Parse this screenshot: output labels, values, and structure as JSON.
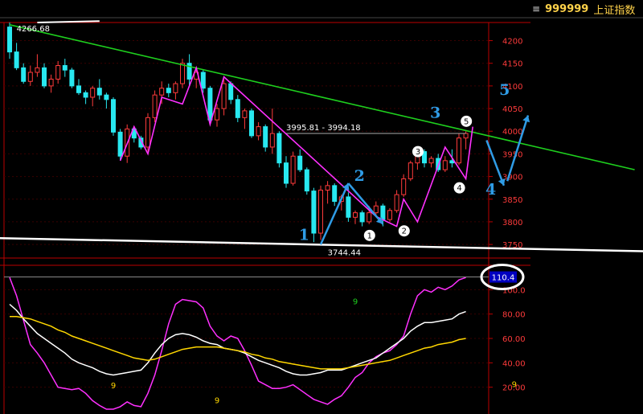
{
  "header": {
    "menu_glyph": "≡",
    "code": "999999",
    "name": "上证指数"
  },
  "chart_data": [
    {
      "type": "candlestick",
      "title": "",
      "ylim": [
        3720,
        4240
      ],
      "y_ticks": [
        "4200",
        "4150",
        "4100",
        "4050",
        "4000",
        "3950",
        "3900",
        "3850",
        "3800",
        "3750"
      ],
      "y_tick_values": [
        4200,
        4150,
        4100,
        4050,
        4000,
        3950,
        3900,
        3850,
        3800,
        3750
      ],
      "high_label": "4266.68",
      "low_label": "3744.44",
      "low_label_value": 3744,
      "range_label": "3995.81 - 3994.18",
      "range_value": 3995,
      "colors": {
        "up": "#ff3b3b",
        "down": "#28e8f0",
        "trendline": "#1ecf1e",
        "zigzag": "#ff30ff",
        "arrow": "#2f9ce6",
        "support": "#ffffff"
      },
      "candles": [
        [
          4230,
          4240,
          4160,
          4175
        ],
        [
          4175,
          4195,
          4135,
          4140
        ],
        [
          4140,
          4150,
          4105,
          4110
        ],
        [
          4110,
          4145,
          4100,
          4130
        ],
        [
          4130,
          4170,
          4120,
          4140
        ],
        [
          4140,
          4150,
          4095,
          4100
        ],
        [
          4100,
          4125,
          4085,
          4115
        ],
        [
          4115,
          4155,
          4105,
          4145
        ],
        [
          4145,
          4160,
          4120,
          4135
        ],
        [
          4135,
          4140,
          4095,
          4100
        ],
        [
          4100,
          4115,
          4080,
          4085
        ],
        [
          4085,
          4090,
          4060,
          4075
        ],
        [
          4075,
          4100,
          4055,
          4095
        ],
        [
          4095,
          4115,
          4070,
          4080
        ],
        [
          4080,
          4085,
          4050,
          4070
        ],
        [
          4070,
          4075,
          3990,
          3998
        ],
        [
          3998,
          4005,
          3935,
          3945
        ],
        [
          3945,
          4015,
          3930,
          4005
        ],
        [
          4005,
          4010,
          3975,
          3985
        ],
        [
          3985,
          3990,
          3960,
          3965
        ],
        [
          3965,
          4040,
          3955,
          4030
        ],
        [
          4030,
          4090,
          4020,
          4080
        ],
        [
          4080,
          4110,
          4060,
          4095
        ],
        [
          4095,
          4105,
          4075,
          4085
        ],
        [
          4085,
          4110,
          4070,
          4105
        ],
        [
          4105,
          4160,
          4095,
          4150
        ],
        [
          4150,
          4170,
          4100,
          4115
        ],
        [
          4115,
          4140,
          4095,
          4130
        ],
        [
          4130,
          4135,
          4085,
          4095
        ],
        [
          4095,
          4100,
          4015,
          4025
        ],
        [
          4025,
          4060,
          4010,
          4050
        ],
        [
          4050,
          4115,
          4035,
          4105
        ],
        [
          4105,
          4110,
          4060,
          4070
        ],
        [
          4070,
          4080,
          4020,
          4030
        ],
        [
          4030,
          4050,
          4005,
          4045
        ],
        [
          4045,
          4050,
          3985,
          3990
        ],
        [
          3990,
          4020,
          3980,
          4010
        ],
        [
          4010,
          4015,
          3955,
          3965
        ],
        [
          3965,
          4050,
          3950,
          3995
        ],
        [
          3995,
          4000,
          3920,
          3930
        ],
        [
          3930,
          3945,
          3875,
          3885
        ],
        [
          3885,
          3955,
          3880,
          3945
        ],
        [
          3945,
          3960,
          3910,
          3915
        ],
        [
          3915,
          3920,
          3860,
          3868
        ],
        [
          3868,
          3875,
          3755,
          3775
        ],
        [
          3775,
          3880,
          3760,
          3870
        ],
        [
          3870,
          3890,
          3840,
          3880
        ],
        [
          3880,
          3885,
          3835,
          3845
        ],
        [
          3845,
          3860,
          3825,
          3855
        ],
        [
          3855,
          3865,
          3800,
          3810
        ],
        [
          3810,
          3825,
          3795,
          3820
        ],
        [
          3820,
          3825,
          3790,
          3800
        ],
        [
          3800,
          3835,
          3795,
          3820
        ],
        [
          3820,
          3845,
          3810,
          3835
        ],
        [
          3835,
          3840,
          3790,
          3805
        ],
        [
          3805,
          3830,
          3800,
          3825
        ],
        [
          3825,
          3870,
          3820,
          3860
        ],
        [
          3860,
          3905,
          3855,
          3895
        ],
        [
          3895,
          3935,
          3890,
          3930
        ],
        [
          3930,
          3965,
          3915,
          3955
        ],
        [
          3955,
          3960,
          3920,
          3930
        ],
        [
          3930,
          3945,
          3920,
          3940
        ],
        [
          3940,
          3950,
          3910,
          3915
        ],
        [
          3915,
          3945,
          3910,
          3935
        ],
        [
          3935,
          3960,
          3920,
          3930
        ],
        [
          3930,
          3995,
          3925,
          3985
        ],
        [
          3985,
          4000,
          3960,
          3995
        ]
      ]
    },
    {
      "type": "line",
      "title": "",
      "ylim": [
        0,
        120
      ],
      "y_ticks": [
        "100.0",
        "80.00",
        "60.00",
        "40.00",
        "20.00"
      ],
      "y_tick_values": [
        100,
        80,
        60,
        40,
        20
      ],
      "value_badge": "110.4",
      "value_badge_value": 110.4,
      "annotations": [
        {
          "text": "9",
          "x": 50,
          "y": 88,
          "color": "#1ecf1e"
        },
        {
          "text": "9",
          "x": 15,
          "y": 19,
          "color": "#ffd700"
        },
        {
          "text": "9",
          "x": 30,
          "y": 7,
          "color": "#ffd700"
        },
        {
          "text": "9",
          "x": 73,
          "y": 20,
          "color": "#ffd700"
        }
      ],
      "series": [
        {
          "color": "#ff30ff",
          "values": [
            110,
            95,
            75,
            55,
            48,
            40,
            30,
            20,
            19,
            18,
            19,
            15,
            9,
            5,
            2,
            2,
            4,
            8,
            5,
            4,
            15,
            30,
            50,
            72,
            88,
            92,
            91,
            90,
            85,
            70,
            62,
            58,
            62,
            60,
            50,
            38,
            25,
            22,
            19,
            19,
            20,
            22,
            18,
            14,
            10,
            8,
            6,
            10,
            13,
            20,
            28,
            32,
            40,
            45,
            48,
            50,
            55,
            62,
            80,
            95,
            100,
            98,
            102,
            100,
            103,
            108,
            110
          ]
        },
        {
          "color": "#ffffff",
          "values": [
            88,
            83,
            76,
            70,
            64,
            60,
            56,
            52,
            48,
            43,
            40,
            38,
            36,
            33,
            31,
            30,
            31,
            32,
            33,
            34,
            40,
            48,
            55,
            60,
            63,
            64,
            63,
            61,
            58,
            56,
            55,
            52,
            51,
            50,
            48,
            45,
            42,
            40,
            38,
            36,
            33,
            31,
            30,
            30,
            31,
            32,
            34,
            34,
            34,
            36,
            38,
            40,
            42,
            44,
            48,
            52,
            56,
            60,
            66,
            70,
            73,
            73,
            74,
            75,
            76,
            80,
            82
          ]
        },
        {
          "color": "#ffd700",
          "values": [
            78,
            78,
            77,
            76,
            74,
            72,
            70,
            67,
            65,
            62,
            60,
            58,
            56,
            54,
            52,
            50,
            48,
            46,
            44,
            43,
            42,
            43,
            45,
            47,
            49,
            51,
            52,
            53,
            53,
            53,
            53,
            52,
            51,
            50,
            49,
            47,
            46,
            44,
            43,
            41,
            40,
            39,
            38,
            37,
            36,
            35,
            35,
            35,
            35,
            36,
            37,
            38,
            39,
            40,
            41,
            42,
            44,
            46,
            48,
            50,
            52,
            53,
            55,
            56,
            57,
            59,
            60
          ]
        }
      ]
    }
  ],
  "annotation_labels": {
    "wave_large": [
      {
        "text": "1",
        "idx": 44,
        "price": 3760
      },
      {
        "text": "2",
        "idx": 52,
        "price": 3890
      },
      {
        "text": "3",
        "idx": 63,
        "price": 4030
      },
      {
        "text": "4",
        "idx": 71,
        "price": 3860
      },
      {
        "text": "5",
        "idx": 73,
        "price": 4080
      }
    ],
    "wave_small": [
      {
        "text": "1",
        "idx": 53,
        "price": 3770
      },
      {
        "text": "2",
        "idx": 58,
        "price": 3780
      },
      {
        "text": "3",
        "idx": 60,
        "price": 3955
      },
      {
        "text": "4",
        "idx": 66,
        "price": 3875
      },
      {
        "text": "5",
        "idx": 67,
        "price": 4022
      }
    ]
  }
}
